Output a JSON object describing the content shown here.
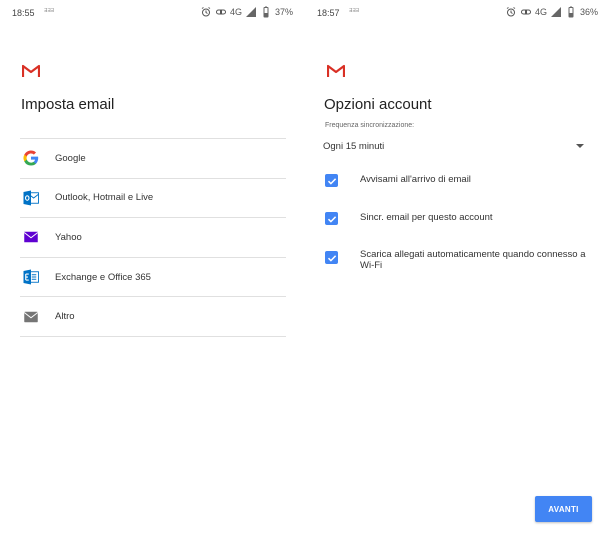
{
  "left_screen": {
    "status": {
      "time": "18:55",
      "notif": "ƎƎƎ",
      "network": "4G",
      "battery": "37%"
    },
    "title": "Imposta email",
    "providers": [
      {
        "label": "Google",
        "icon": "google-icon"
      },
      {
        "label": "Outlook, Hotmail e Live",
        "icon": "outlook-icon"
      },
      {
        "label": "Yahoo",
        "icon": "yahoo-mail-icon"
      },
      {
        "label": "Exchange e Office 365",
        "icon": "exchange-icon"
      },
      {
        "label": "Altro",
        "icon": "mail-icon"
      }
    ]
  },
  "right_screen": {
    "status": {
      "time": "18:57",
      "notif": "ƎƎƎ",
      "network": "4G",
      "battery": "36%"
    },
    "title": "Opzioni account",
    "sync_label": "Frequenza sincronizzazione:",
    "sync_value": "Ogni 15 minuti",
    "options": [
      {
        "label": "Avvisami all'arrivo di email",
        "checked": true
      },
      {
        "label": "Sincr. email per questo account",
        "checked": true
      },
      {
        "label": "Scarica allegati automaticamente quando connesso a Wi-Fi",
        "checked": true
      }
    ],
    "next_label": "AVANTI"
  },
  "colors": {
    "accent": "#4285f4",
    "gmail_red": "#d93025",
    "divider": "#e0e0e0",
    "yahoo_purple": "#5f01d1",
    "outlook_blue": "#0072c6"
  }
}
